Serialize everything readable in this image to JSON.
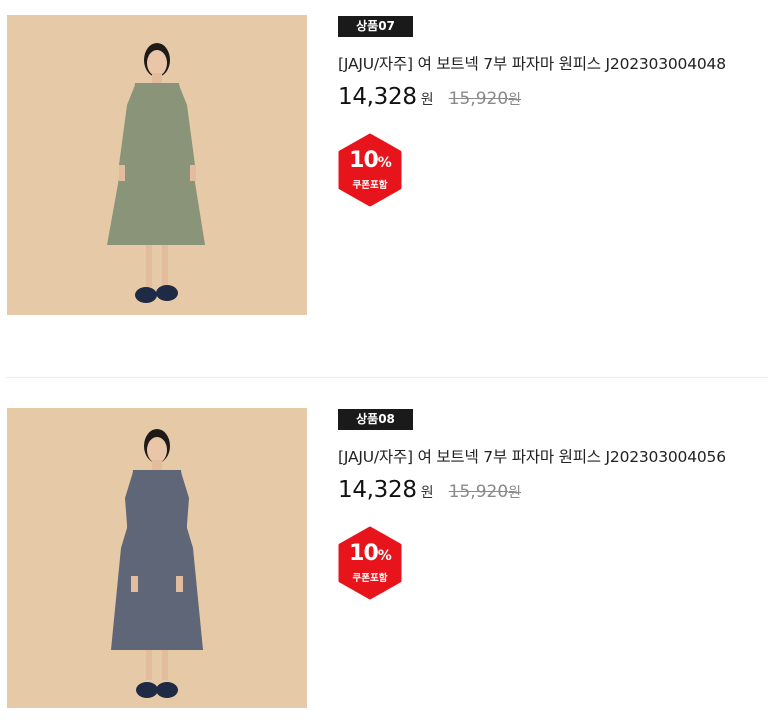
{
  "products": [
    {
      "badge": "상품07",
      "title": "[JAJU/자주] 여 보트넥 7부 파자마 원피스 J202303004048",
      "price": "14,328",
      "price_unit": "원",
      "original_price": "15,920",
      "original_unit": "원",
      "coupon_rate": "10",
      "coupon_sign": "%",
      "coupon_label": "쿠폰포함",
      "dress_color": "#8a9478",
      "image_icon": "model-dress-photo"
    },
    {
      "badge": "상품08",
      "title": "[JAJU/자주] 여 보트넥 7부 파자마 원피스 J202303004056",
      "price": "14,328",
      "price_unit": "원",
      "original_price": "15,920",
      "original_unit": "원",
      "coupon_rate": "10",
      "coupon_sign": "%",
      "coupon_label": "쿠폰포함",
      "dress_color": "#5f6678",
      "image_icon": "model-dress-photo"
    }
  ],
  "colors": {
    "badge_bg": "#1a1a1a",
    "coupon_red": "#e8141b",
    "photo_bg": "#e6c9a6",
    "strike_gray": "#8a8a8a"
  }
}
